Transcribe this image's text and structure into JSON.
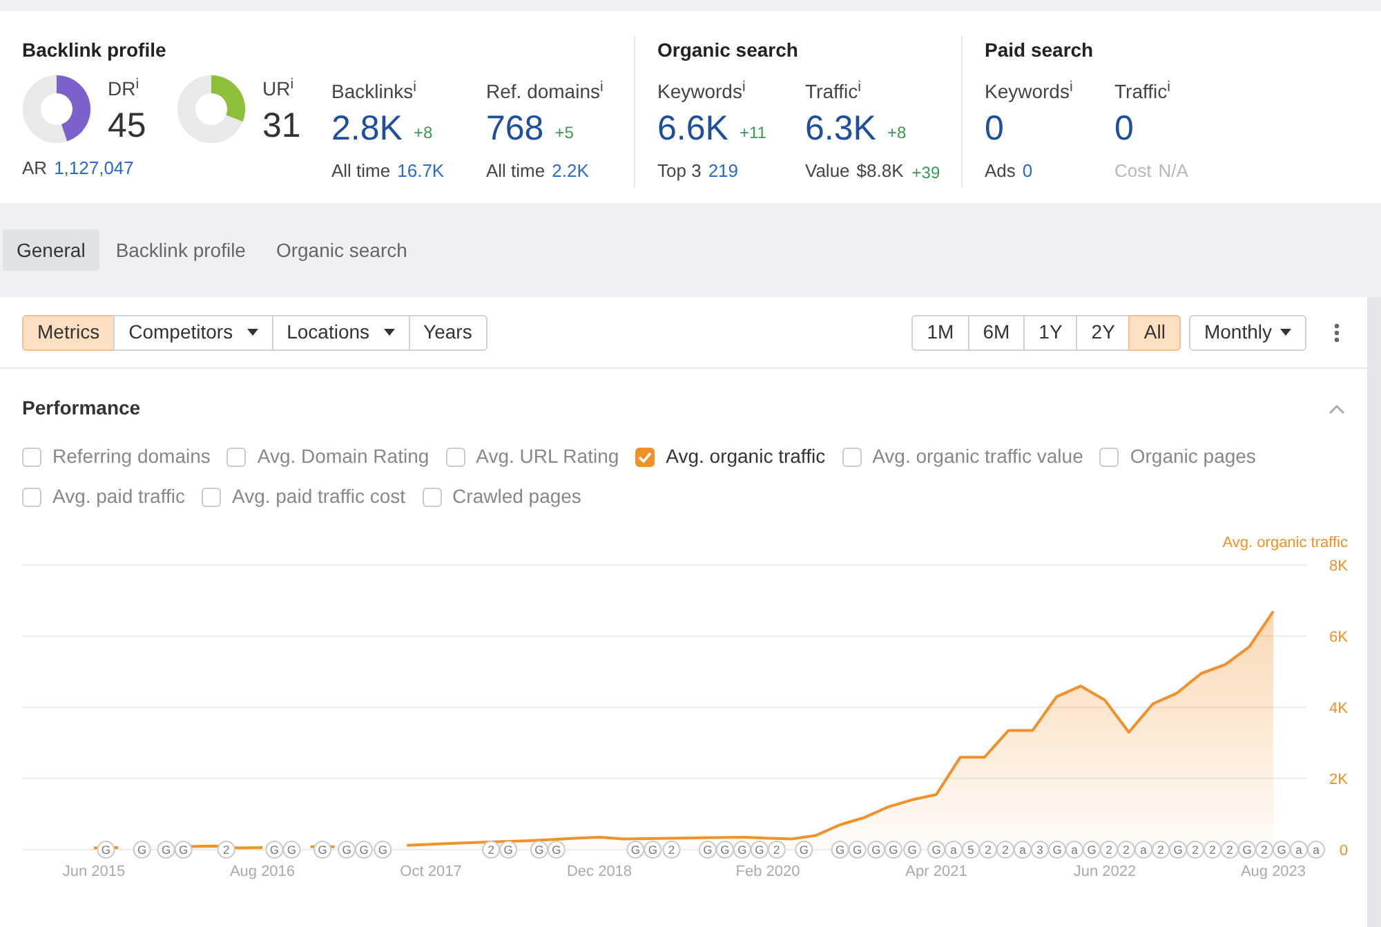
{
  "sections": [
    {
      "title": "Backlink profile",
      "metrics": [
        {
          "kind": "ring",
          "label": "DR$^{i}$",
          "value": "45",
          "color": "#7b61c9",
          "sub_label": "AR",
          "sub_value": "1,127,047"
        },
        {
          "kind": "ring",
          "label": "UR$^{i}$",
          "value": "31",
          "color": "#8dbf3a"
        },
        {
          "kind": "stat",
          "label": "Backlinks$^{i}$",
          "value": "2.8K",
          "delta": "+8",
          "sub_label": "All time",
          "sub_value": "16.7K"
        },
        {
          "kind": "stat",
          "label": "Ref. domains$^{i}$",
          "value": "768",
          "delta": "+5",
          "sub_label": "All time",
          "sub_value": "2.2K"
        }
      ]
    },
    {
      "title": "Organic search",
      "metrics": [
        {
          "kind": "stat",
          "label": "Keywords$^{i}$",
          "value": "6.6K",
          "delta": "+11",
          "sub_label": "Top 3",
          "sub_value": "219"
        },
        {
          "kind": "stat",
          "label": "Traffic$^{i}$",
          "value": "6.3K",
          "delta": "+8",
          "sub_label": "Value",
          "sub_value": "$8.8K",
          "sub_delta": "+39"
        }
      ]
    },
    {
      "title": "Paid search",
      "metrics": [
        {
          "kind": "stat",
          "label": "Keywords$^{i}$",
          "value": "0",
          "sub_label": "Ads",
          "sub_value": "0"
        },
        {
          "kind": "stat",
          "label": "Traffic$^{i}$",
          "value": "0",
          "sub_label": "Cost",
          "sub_value": "N/A",
          "sub_disabled": true
        }
      ]
    }
  ],
  "tabs": [
    {
      "label": "General",
      "selected": true
    },
    {
      "label": "Backlink profile",
      "selected": false
    },
    {
      "label": "Organic search",
      "selected": false
    }
  ],
  "view_buttons": [
    {
      "label": "Metrics",
      "selected": true,
      "dropdown": false
    },
    {
      "label": "Competitors",
      "selected": false,
      "dropdown": true
    },
    {
      "label": "Locations",
      "selected": false,
      "dropdown": true
    },
    {
      "label": "Years",
      "selected": false,
      "dropdown": false
    }
  ],
  "range_buttons": [
    {
      "label": "1M",
      "selected": false
    },
    {
      "label": "6M",
      "selected": false
    },
    {
      "label": "1Y",
      "selected": false
    },
    {
      "label": "2Y",
      "selected": false
    },
    {
      "label": "All",
      "selected": true
    }
  ],
  "interval": "Monthly",
  "performance": {
    "title": "Performance",
    "expanded": true,
    "options": [
      [
        {
          "label": "Referring domains",
          "checked": false
        },
        {
          "label": "Avg. Domain Rating",
          "checked": false
        },
        {
          "label": "Avg. URL Rating",
          "checked": false
        },
        {
          "label": "Avg. organic traffic",
          "checked": true
        },
        {
          "label": "Avg. organic traffic value",
          "checked": false
        },
        {
          "label": "Organic pages",
          "checked": false
        }
      ],
      [
        {
          "label": "Avg. paid traffic",
          "checked": false
        },
        {
          "label": "Avg. paid traffic cost",
          "checked": false
        },
        {
          "label": "Crawled pages",
          "checked": false
        }
      ]
    ],
    "chart_data": {
      "type": "area",
      "categories": [
        "Jun 2015",
        null,
        null,
        null,
        null,
        null,
        null,
        "Aug 2016",
        null,
        null,
        null,
        null,
        null,
        null,
        "Oct 2017",
        null,
        null,
        null,
        null,
        null,
        null,
        "Dec 2018",
        null,
        null,
        null,
        null,
        null,
        null,
        "Feb 2020",
        null,
        null,
        null,
        null,
        null,
        null,
        "Apr 2021",
        null,
        null,
        null,
        null,
        null,
        null,
        "Jun 2022",
        null,
        null,
        null,
        null,
        null,
        null,
        "Aug 2023"
      ],
      "series": [
        {
          "name": "Avg. organic traffic",
          "color": "#f0912a",
          "values": [
            50,
            60,
            null,
            null,
            90,
            100,
            50,
            60,
            null,
            80,
            80,
            null,
            null,
            120,
            150,
            180,
            200,
            230,
            250,
            280,
            320,
            350,
            300,
            310,
            320,
            330,
            340,
            350,
            320,
            300,
            400,
            700,
            900,
            1200,
            1400,
            1550,
            2600,
            2600,
            3350,
            3350,
            4300,
            4600,
            4200,
            3300,
            4100,
            4400,
            4950,
            5200,
            5700,
            6700
          ]
        }
      ],
      "ylim": [
        0,
        8000
      ],
      "grid": true,
      "yticks": [
        {
          "value": 0,
          "label": "0"
        },
        {
          "value": 2000,
          "label": "2K"
        },
        {
          "value": 4000,
          "label": "4K"
        },
        {
          "value": 6000,
          "label": "6K"
        },
        {
          "value": 8000,
          "label": "8K"
        }
      ]
    },
    "event_markers": [
      {
        "kind": "gap"
      },
      {
        "kind": "marker",
        "text": "G"
      },
      {
        "kind": "gap"
      },
      {
        "kind": "gap"
      },
      {
        "kind": "marker",
        "text": "G"
      },
      {
        "kind": "gap"
      },
      {
        "kind": "marker",
        "text": "G"
      },
      {
        "kind": "marker",
        "text": "G"
      },
      {
        "kind": "gap"
      },
      {
        "kind": "gap"
      },
      {
        "kind": "gap"
      },
      {
        "kind": "marker",
        "text": "2"
      },
      {
        "kind": "gap"
      },
      {
        "kind": "gap"
      },
      {
        "kind": "gap"
      },
      {
        "kind": "marker",
        "text": "G"
      },
      {
        "kind": "marker",
        "text": "G"
      },
      {
        "kind": "gap"
      },
      {
        "kind": "gap"
      },
      {
        "kind": "marker",
        "text": "G"
      },
      {
        "kind": "gap"
      },
      {
        "kind": "marker",
        "text": "G"
      },
      {
        "kind": "marker",
        "text": "G"
      },
      {
        "kind": "gap"
      },
      {
        "kind": "marker",
        "text": "G"
      },
      {
        "kind": "gap"
      },
      {
        "kind": "gap"
      },
      {
        "kind": "gap"
      },
      {
        "kind": "gap"
      },
      {
        "kind": "gap"
      },
      {
        "kind": "gap"
      },
      {
        "kind": "gap"
      },
      {
        "kind": "gap"
      },
      {
        "kind": "marker",
        "text": "2"
      },
      {
        "kind": "marker",
        "text": "G"
      },
      {
        "kind": "gap"
      },
      {
        "kind": "gap"
      },
      {
        "kind": "marker",
        "text": "G"
      },
      {
        "kind": "marker",
        "text": "G"
      },
      {
        "kind": "gap"
      },
      {
        "kind": "gap"
      },
      {
        "kind": "gap"
      },
      {
        "kind": "gap"
      },
      {
        "kind": "gap"
      },
      {
        "kind": "gap"
      },
      {
        "kind": "marker",
        "text": "G"
      },
      {
        "kind": "marker",
        "text": "G"
      },
      {
        "kind": "gap"
      },
      {
        "kind": "marker",
        "text": "2"
      },
      {
        "kind": "gap"
      },
      {
        "kind": "gap"
      },
      {
        "kind": "marker",
        "text": "G"
      },
      {
        "kind": "marker",
        "text": "G"
      },
      {
        "kind": "marker",
        "text": "G"
      },
      {
        "kind": "marker",
        "text": "G"
      },
      {
        "kind": "marker",
        "text": "2"
      },
      {
        "kind": "gap"
      },
      {
        "kind": "gap"
      },
      {
        "kind": "gap"
      },
      {
        "kind": "marker",
        "text": "G"
      },
      {
        "kind": "gap"
      },
      {
        "kind": "gap"
      },
      {
        "kind": "marker",
        "text": "G"
      },
      {
        "kind": "marker",
        "text": "G"
      },
      {
        "kind": "gap"
      },
      {
        "kind": "marker",
        "text": "G"
      },
      {
        "kind": "marker",
        "text": "G"
      },
      {
        "kind": "gap"
      },
      {
        "kind": "marker",
        "text": "G"
      },
      {
        "kind": "gap"
      },
      {
        "kind": "marker",
        "text": "G"
      },
      {
        "kind": "marker",
        "text": "a"
      },
      {
        "kind": "marker",
        "text": "5"
      },
      {
        "kind": "marker",
        "text": "2"
      },
      {
        "kind": "marker",
        "text": "2"
      },
      {
        "kind": "marker",
        "text": "a"
      },
      {
        "kind": "gap"
      },
      {
        "kind": "marker",
        "text": "3"
      },
      {
        "kind": "marker",
        "text": "G"
      },
      {
        "kind": "marker",
        "text": "a"
      },
      {
        "kind": "marker",
        "text": "G"
      },
      {
        "kind": "marker",
        "text": "2"
      },
      {
        "kind": "gap"
      },
      {
        "kind": "marker",
        "text": "2"
      },
      {
        "kind": "marker",
        "text": "a"
      },
      {
        "kind": "marker",
        "text": "2"
      },
      {
        "kind": "marker",
        "text": "G"
      },
      {
        "kind": "marker",
        "text": "2"
      },
      {
        "kind": "marker",
        "text": "2"
      },
      {
        "kind": "gap"
      },
      {
        "kind": "marker",
        "text": "2"
      },
      {
        "kind": "gap"
      },
      {
        "kind": "marker",
        "text": "G"
      },
      {
        "kind": "marker",
        "text": "2"
      },
      {
        "kind": "marker",
        "text": "G"
      },
      {
        "kind": "gap"
      },
      {
        "kind": "marker",
        "text": "a"
      },
      {
        "kind": "marker",
        "text": "a"
      }
    ]
  }
}
